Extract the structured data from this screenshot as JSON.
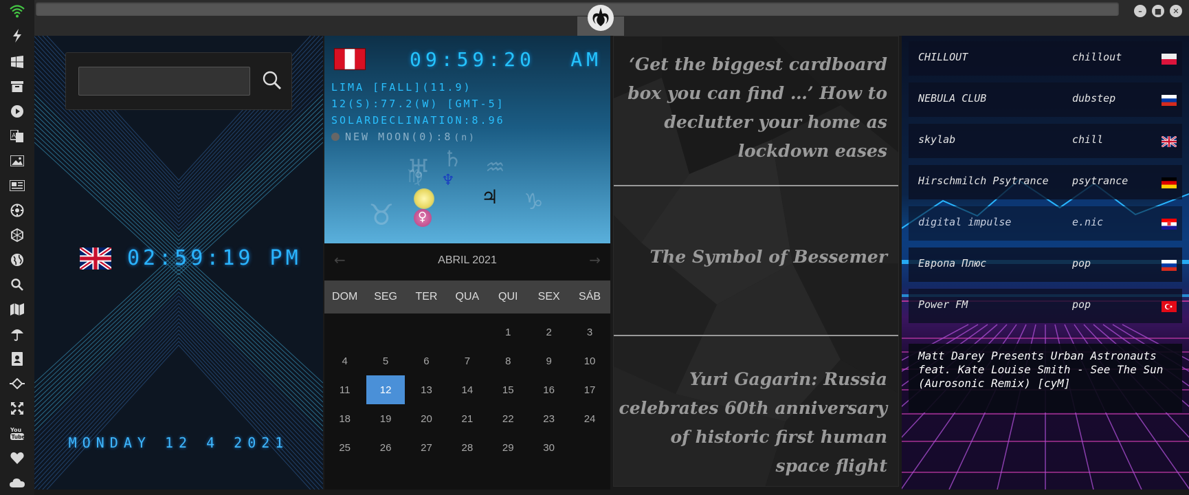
{
  "sidebar": {
    "icons": [
      "wifi-icon",
      "lightning-icon",
      "windows-icon",
      "archive-icon",
      "play-icon",
      "translate-icon",
      "image-icon",
      "news-icon",
      "settings-icon",
      "hexagon-icon",
      "globe-icon",
      "search-icon",
      "map-icon",
      "umbrella-icon",
      "contacts-icon",
      "ticket-icon",
      "fullscreen-icon",
      "youtube-icon",
      "heart-icon",
      "cloud-icon"
    ],
    "accent": "#44c744"
  },
  "clock": {
    "time": "02:59:19 PM",
    "date": "MONDAY 12 4 2021",
    "flag": "UK",
    "color": "#2ab4ff"
  },
  "astro": {
    "flag": "Peru",
    "time": "09:59:20",
    "ampm": "AM",
    "line1": "LIMA [FALL](11.9)",
    "line2": "12(S):77.2(W) [GMT-5]",
    "line3": "SOLARDECLINATION:8.96",
    "line4": "NEW MOON(0):8",
    "line4_suffix": "(n)",
    "glyphs": [
      "♅",
      "♄",
      "♒",
      "♆",
      "♃",
      "♉",
      "♀",
      "♑",
      "♍"
    ]
  },
  "calendar": {
    "month": "ABRIL 2021",
    "prev": "←",
    "next": "→",
    "weekdays": [
      "DOM",
      "SEG",
      "TER",
      "QUA",
      "QUI",
      "SEX",
      "SÁB"
    ],
    "leading_blanks": 4,
    "days": [
      "1",
      "2",
      "3",
      "4",
      "5",
      "6",
      "7",
      "8",
      "9",
      "10",
      "11",
      "12",
      "13",
      "14",
      "15",
      "16",
      "17",
      "18",
      "19",
      "20",
      "21",
      "22",
      "23",
      "24",
      "25",
      "26",
      "27",
      "28",
      "29",
      "30"
    ],
    "today": "12",
    "accent": "#4a90d8"
  },
  "news": {
    "items": [
      "‘Get the biggest cardboard box you can find …’ How to declutter your home as lockdown eases",
      "The Symbol of Bessemer",
      "Yuri Gagarin: Russia celebrates 60th anniversary of historic first human space flight"
    ]
  },
  "radio": {
    "stations": [
      {
        "name": "CHILLOUT",
        "genre": "chillout",
        "flag": "pl"
      },
      {
        "name": "NEBULA CLUB",
        "genre": "dubstep",
        "flag": "ru"
      },
      {
        "name": "skylab",
        "genre": "chill",
        "flag": "gb"
      },
      {
        "name": "Hirschmilch Psytrance",
        "genre": "psytrance",
        "flag": "de"
      },
      {
        "name": "digital impulse",
        "genre": "e.nic",
        "flag": "hr"
      },
      {
        "name": "Европа Плюс",
        "genre": "pop",
        "flag": "ru"
      },
      {
        "name": "Power FM",
        "genre": "pop",
        "flag": "tr"
      }
    ],
    "now_playing": "Matt Darey Presents Urban Astronauts feat. Kate Louise Smith - See The Sun (Aurosonic Remix) [cyM]"
  },
  "window": {
    "minimize": "–",
    "maximize": "■",
    "close": "✕"
  }
}
